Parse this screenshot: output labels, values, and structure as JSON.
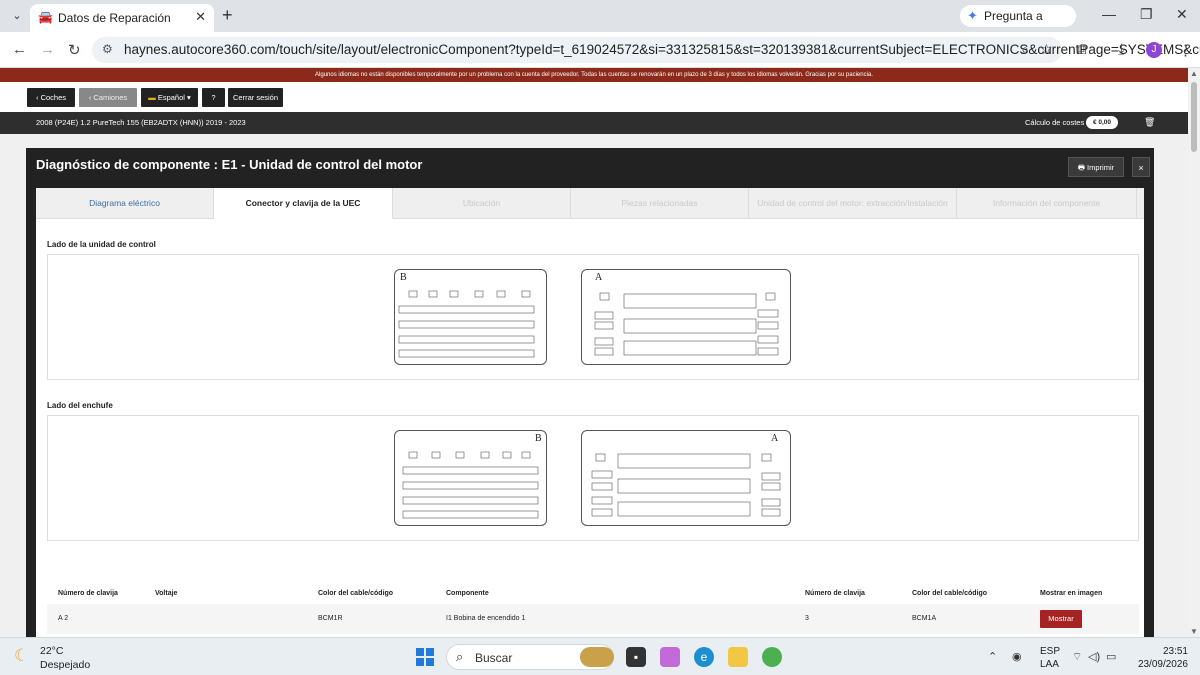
{
  "browser": {
    "tab_title": "Datos de Reparación",
    "gemini_label": "Pregunta a Gemini",
    "url": "haynes.autocore360.com/touch/site/layout/electronicComponent?typeId=t_619024572&si=331325815&st=320139381&currentSubject=ELECTRONICS&currentPage=SYSTEMS&cur...",
    "avatar_letter": "J"
  },
  "banner": "Algunos idiomas no están disponibles temporalmente por un problema con la cuenta del proveedor. Todas las cuentas se renovarán en un plazo de 3 días y todos los idiomas volverán. Gracias por su paciencia.",
  "topnav": {
    "cars": "‹ Coches",
    "trucks": "‹ Camiones",
    "language": "Español",
    "help": "?",
    "logout": "Cerrar sesión"
  },
  "vehicle": {
    "name": "2008 (P24E) 1.2 PureTech 155 (EB2ADTX (HNN)) 2019 - 2023",
    "cost_label": "Cálculo de costes",
    "cost_value": "€ 0,00"
  },
  "modal": {
    "title": "Diagnóstico de componente : E1 - Unidad de control del motor",
    "print": "Imprimir",
    "close": "×",
    "tabs": [
      {
        "label": "Diagrama eléctrico",
        "state": "link"
      },
      {
        "label": "Conector y clavija de la UEC",
        "state": "active"
      },
      {
        "label": "Ubicación",
        "state": "off"
      },
      {
        "label": "Piezas relacionadas",
        "state": "off"
      },
      {
        "label": "Unidad de control del motor: extracción/instalación",
        "state": "off"
      },
      {
        "label": "Información del componente",
        "state": "off"
      }
    ],
    "section_control": "Lado de la unidad de control",
    "section_plug": "Lado del enchufe",
    "connector_b": "B",
    "connector_a": "A"
  },
  "table": {
    "headers": [
      "Número de clavija",
      "Voltaje",
      "Color del cable/código",
      "Componente",
      "Número de clavija",
      "Color del cable/código",
      "Mostrar en imagen"
    ],
    "rows": [
      {
        "pin": "A 2",
        "voltage": "",
        "color": "BCM1R",
        "component": "I1 Bobina de encendido 1",
        "pin2": "3",
        "color2": "BCM1A",
        "button": "Mostrar"
      }
    ]
  },
  "taskbar": {
    "temp": "22°C",
    "condition": "Despejado",
    "search": "Buscar",
    "lang_top": "ESP",
    "lang_bottom": "LAA",
    "time": "23:51",
    "date": "23/09/2026"
  },
  "colors": {
    "banner": "#8b2a1b",
    "dark": "#222222",
    "link": "#3b6ea5",
    "button_red": "#a62323"
  }
}
